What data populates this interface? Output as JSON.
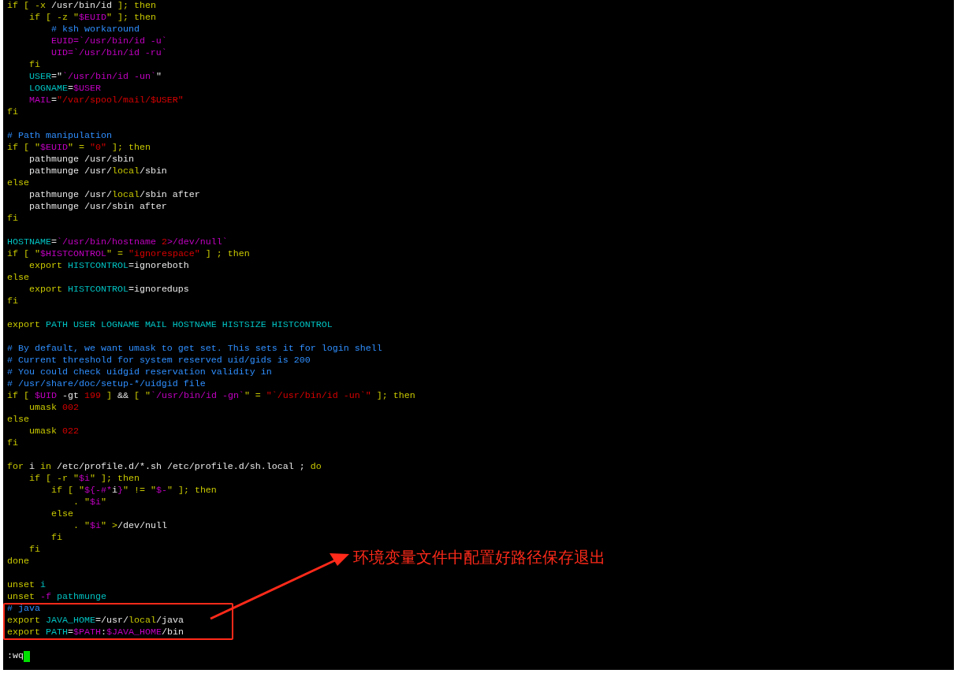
{
  "editor": {
    "lines": [
      {
        "kind": "code",
        "tokens": [
          {
            "kind": "keyword",
            "text": "if [ -x"
          },
          {
            "kind": "plain",
            "text": " /usr/bin/id "
          },
          {
            "kind": "keyword",
            "text": "]; then"
          }
        ]
      },
      {
        "kind": "code",
        "tokens": [
          {
            "kind": "keyword",
            "text": "    if [ -z \""
          },
          {
            "kind": "variable",
            "text": "$EUID"
          },
          {
            "kind": "keyword",
            "text": "\" ]; then"
          }
        ]
      },
      {
        "kind": "code",
        "tokens": [
          {
            "kind": "comment",
            "text": "        # ksh workaround"
          }
        ]
      },
      {
        "kind": "code",
        "tokens": [
          {
            "kind": "variable",
            "text": "        EUID=`/usr/bin/id -u`"
          }
        ]
      },
      {
        "kind": "code",
        "tokens": [
          {
            "kind": "variable",
            "text": "        UID=`/usr/bin/id -ru`"
          }
        ]
      },
      {
        "kind": "code",
        "tokens": [
          {
            "kind": "keyword",
            "text": "    fi"
          }
        ]
      },
      {
        "kind": "code",
        "tokens": [
          {
            "kind": "ident",
            "text": "    USER"
          },
          {
            "kind": "plain",
            "text": "=\""
          },
          {
            "kind": "variable",
            "text": "`/usr/bin/id -un`"
          },
          {
            "kind": "plain",
            "text": "\""
          }
        ]
      },
      {
        "kind": "code",
        "tokens": [
          {
            "kind": "ident",
            "text": "    LOGNAME"
          },
          {
            "kind": "plain",
            "text": "="
          },
          {
            "kind": "variable",
            "text": "$USER"
          }
        ]
      },
      {
        "kind": "code",
        "tokens": [
          {
            "kind": "variable",
            "text": "    MAIL"
          },
          {
            "kind": "plain",
            "text": "="
          },
          {
            "kind": "string",
            "text": "\"/var/spool/mail/$USER\""
          }
        ]
      },
      {
        "kind": "code",
        "tokens": [
          {
            "kind": "keyword",
            "text": "fi"
          }
        ]
      },
      {
        "kind": "blank"
      },
      {
        "kind": "code",
        "tokens": [
          {
            "kind": "comment",
            "text": "# Path manipulation"
          }
        ]
      },
      {
        "kind": "code",
        "tokens": [
          {
            "kind": "keyword",
            "text": "if [ \""
          },
          {
            "kind": "variable",
            "text": "$EUID"
          },
          {
            "kind": "keyword",
            "text": "\" = "
          },
          {
            "kind": "string",
            "text": "\"0\""
          },
          {
            "kind": "keyword",
            "text": " ]; then"
          }
        ]
      },
      {
        "kind": "code",
        "tokens": [
          {
            "kind": "plain",
            "text": "    pathmunge /usr/sbin"
          }
        ]
      },
      {
        "kind": "code",
        "tokens": [
          {
            "kind": "plain",
            "text": "    pathmunge /usr/"
          },
          {
            "kind": "keyword",
            "text": "local"
          },
          {
            "kind": "plain",
            "text": "/sbin"
          }
        ]
      },
      {
        "kind": "code",
        "tokens": [
          {
            "kind": "keyword",
            "text": "else"
          }
        ]
      },
      {
        "kind": "code",
        "tokens": [
          {
            "kind": "plain",
            "text": "    pathmunge /usr/"
          },
          {
            "kind": "keyword",
            "text": "local"
          },
          {
            "kind": "plain",
            "text": "/sbin after"
          }
        ]
      },
      {
        "kind": "code",
        "tokens": [
          {
            "kind": "plain",
            "text": "    pathmunge /usr/sbin after"
          }
        ]
      },
      {
        "kind": "code",
        "tokens": [
          {
            "kind": "keyword",
            "text": "fi"
          }
        ]
      },
      {
        "kind": "blank"
      },
      {
        "kind": "code",
        "tokens": [
          {
            "kind": "ident",
            "text": "HOSTNAME"
          },
          {
            "kind": "plain",
            "text": "="
          },
          {
            "kind": "variable",
            "text": "`/usr/bin/hostname "
          },
          {
            "kind": "string",
            "text": "2"
          },
          {
            "kind": "variable",
            "text": ">/dev/null`"
          }
        ]
      },
      {
        "kind": "code",
        "tokens": [
          {
            "kind": "keyword",
            "text": "if [ \""
          },
          {
            "kind": "variable",
            "text": "$HISTCONTROL"
          },
          {
            "kind": "keyword",
            "text": "\" = "
          },
          {
            "kind": "string",
            "text": "\"ignorespace\""
          },
          {
            "kind": "keyword",
            "text": " ] ; then"
          }
        ]
      },
      {
        "kind": "code",
        "tokens": [
          {
            "kind": "keyword",
            "text": "    export "
          },
          {
            "kind": "ident",
            "text": "HISTCONTROL"
          },
          {
            "kind": "plain",
            "text": "=ignoreboth"
          }
        ]
      },
      {
        "kind": "code",
        "tokens": [
          {
            "kind": "keyword",
            "text": "else"
          }
        ]
      },
      {
        "kind": "code",
        "tokens": [
          {
            "kind": "keyword",
            "text": "    export "
          },
          {
            "kind": "ident",
            "text": "HISTCONTROL"
          },
          {
            "kind": "plain",
            "text": "=ignoredups"
          }
        ]
      },
      {
        "kind": "code",
        "tokens": [
          {
            "kind": "keyword",
            "text": "fi"
          }
        ]
      },
      {
        "kind": "blank"
      },
      {
        "kind": "code",
        "tokens": [
          {
            "kind": "keyword",
            "text": "export "
          },
          {
            "kind": "ident",
            "text": "PATH USER LOGNAME MAIL HOSTNAME HISTSIZE HISTCONTROL"
          }
        ]
      },
      {
        "kind": "blank"
      },
      {
        "kind": "code",
        "tokens": [
          {
            "kind": "comment",
            "text": "# By default, we want umask to get set. This sets it for login shell"
          }
        ]
      },
      {
        "kind": "code",
        "tokens": [
          {
            "kind": "comment",
            "text": "# Current threshold for system reserved uid/gids is 200"
          }
        ]
      },
      {
        "kind": "code",
        "tokens": [
          {
            "kind": "comment",
            "text": "# You could check uidgid reservation validity in"
          }
        ]
      },
      {
        "kind": "code",
        "tokens": [
          {
            "kind": "comment",
            "text": "# /usr/share/doc/setup-*/uidgid file"
          }
        ]
      },
      {
        "kind": "code",
        "tokens": [
          {
            "kind": "keyword",
            "text": "if [ "
          },
          {
            "kind": "variable",
            "text": "$UID"
          },
          {
            "kind": "plain",
            "text": " -gt "
          },
          {
            "kind": "string",
            "text": "199"
          },
          {
            "kind": "keyword",
            "text": " ] "
          },
          {
            "kind": "plain",
            "text": "&& "
          },
          {
            "kind": "keyword",
            "text": "[ \""
          },
          {
            "kind": "variable",
            "text": "`/usr/bin/id -gn`"
          },
          {
            "kind": "keyword",
            "text": "\" = "
          },
          {
            "kind": "string",
            "text": "\"`/usr/bin/id -un`\""
          },
          {
            "kind": "keyword",
            "text": " ]; then"
          }
        ]
      },
      {
        "kind": "code",
        "tokens": [
          {
            "kind": "keyword",
            "text": "    umask "
          },
          {
            "kind": "string",
            "text": "002"
          }
        ]
      },
      {
        "kind": "code",
        "tokens": [
          {
            "kind": "keyword",
            "text": "else"
          }
        ]
      },
      {
        "kind": "code",
        "tokens": [
          {
            "kind": "keyword",
            "text": "    umask "
          },
          {
            "kind": "string",
            "text": "022"
          }
        ]
      },
      {
        "kind": "code",
        "tokens": [
          {
            "kind": "keyword",
            "text": "fi"
          }
        ]
      },
      {
        "kind": "blank"
      },
      {
        "kind": "code",
        "tokens": [
          {
            "kind": "keyword",
            "text": "for "
          },
          {
            "kind": "plain",
            "text": "i "
          },
          {
            "kind": "keyword",
            "text": "in "
          },
          {
            "kind": "plain",
            "text": "/etc/profile.d/*.sh /etc/profile.d/sh.local ; "
          },
          {
            "kind": "keyword",
            "text": "do"
          }
        ]
      },
      {
        "kind": "code",
        "tokens": [
          {
            "kind": "keyword",
            "text": "    if [ -r \""
          },
          {
            "kind": "variable",
            "text": "$i"
          },
          {
            "kind": "keyword",
            "text": "\" ]; then"
          }
        ]
      },
      {
        "kind": "code",
        "tokens": [
          {
            "kind": "keyword",
            "text": "        if [ \""
          },
          {
            "kind": "variable",
            "text": "${-#*"
          },
          {
            "kind": "plain",
            "text": "i"
          },
          {
            "kind": "variable",
            "text": "}"
          },
          {
            "kind": "keyword",
            "text": "\" != \""
          },
          {
            "kind": "variable",
            "text": "$-"
          },
          {
            "kind": "keyword",
            "text": "\" ]; then"
          }
        ]
      },
      {
        "kind": "code",
        "tokens": [
          {
            "kind": "keyword",
            "text": "            . \""
          },
          {
            "kind": "variable",
            "text": "$i"
          },
          {
            "kind": "keyword",
            "text": "\""
          }
        ]
      },
      {
        "kind": "code",
        "tokens": [
          {
            "kind": "keyword",
            "text": "        else"
          }
        ]
      },
      {
        "kind": "code",
        "tokens": [
          {
            "kind": "keyword",
            "text": "            . \""
          },
          {
            "kind": "variable",
            "text": "$i"
          },
          {
            "kind": "keyword",
            "text": "\" >"
          },
          {
            "kind": "plain",
            "text": "/dev/null"
          }
        ]
      },
      {
        "kind": "code",
        "tokens": [
          {
            "kind": "keyword",
            "text": "        fi"
          }
        ]
      },
      {
        "kind": "code",
        "tokens": [
          {
            "kind": "keyword",
            "text": "    fi"
          }
        ]
      },
      {
        "kind": "code",
        "tokens": [
          {
            "kind": "keyword",
            "text": "done"
          }
        ]
      },
      {
        "kind": "blank"
      },
      {
        "kind": "code",
        "tokens": [
          {
            "kind": "keyword",
            "text": "unset "
          },
          {
            "kind": "ident",
            "text": "i"
          }
        ]
      },
      {
        "kind": "code",
        "tokens": [
          {
            "kind": "keyword",
            "text": "unset "
          },
          {
            "kind": "variable",
            "text": "-f"
          },
          {
            "kind": "ident",
            "text": " pathmunge"
          }
        ]
      },
      {
        "kind": "code",
        "tokens": [
          {
            "kind": "comment",
            "text": "# java"
          }
        ]
      },
      {
        "kind": "code",
        "tokens": [
          {
            "kind": "keyword",
            "text": "export "
          },
          {
            "kind": "ident",
            "text": "JAVA_HOME"
          },
          {
            "kind": "plain",
            "text": "=/usr/"
          },
          {
            "kind": "keyword",
            "text": "local"
          },
          {
            "kind": "plain",
            "text": "/java"
          }
        ]
      },
      {
        "kind": "code",
        "tokens": [
          {
            "kind": "keyword",
            "text": "export "
          },
          {
            "kind": "ident",
            "text": "PATH"
          },
          {
            "kind": "plain",
            "text": "="
          },
          {
            "kind": "variable",
            "text": "$PATH"
          },
          {
            "kind": "plain",
            "text": ":"
          },
          {
            "kind": "variable",
            "text": "$JAVA_HOME"
          },
          {
            "kind": "plain",
            "text": "/bin"
          }
        ]
      },
      {
        "kind": "blank"
      }
    ],
    "command_line": {
      "text": ":wq"
    }
  },
  "annotation": {
    "text": "环境变量文件中配置好路径保存退出"
  }
}
